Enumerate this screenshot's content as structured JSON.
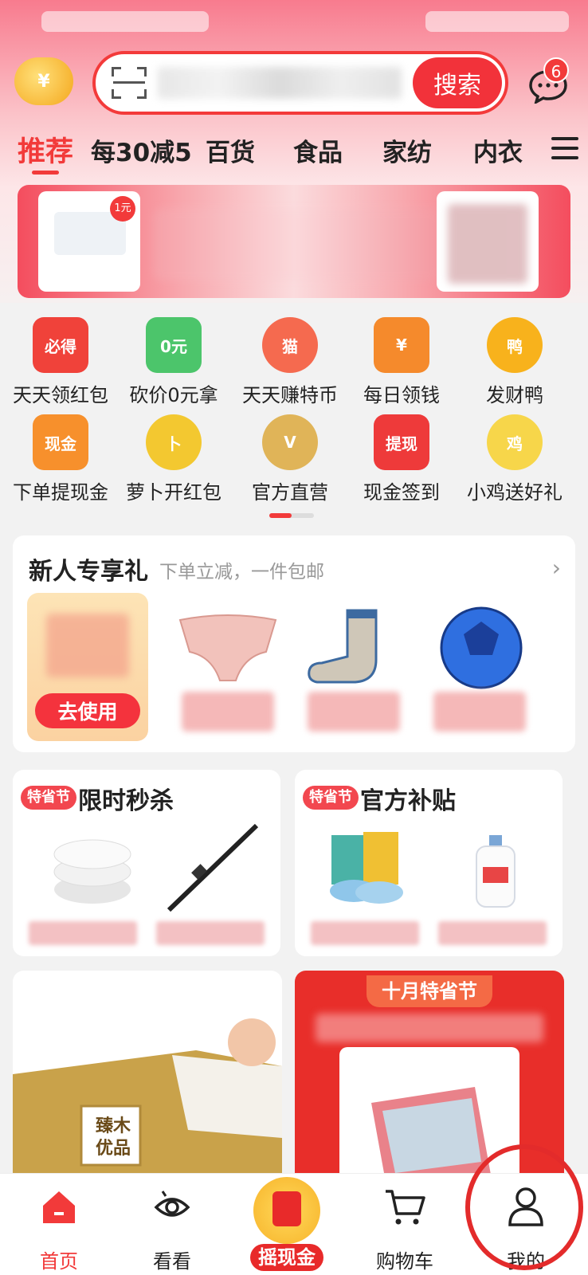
{
  "search": {
    "placeholder": "",
    "button_label": "搜索"
  },
  "messages": {
    "badge_count": "6"
  },
  "coin": {
    "symbol": "¥"
  },
  "tabs": [
    {
      "label": "推荐",
      "active": true
    },
    {
      "label": "每30减5"
    },
    {
      "label": "百货"
    },
    {
      "label": "食品"
    },
    {
      "label": "家纺"
    },
    {
      "label": "内衣"
    }
  ],
  "banner": {
    "left_badge": "1元"
  },
  "grid_items": [
    {
      "label": "天天领红包",
      "icon": "red-envelope-icon",
      "glyph": "必得",
      "color": "#f0423a"
    },
    {
      "label": "砍价0元拿",
      "icon": "zero-yuan-hand-icon",
      "glyph": "0元",
      "color": "#4cc56b"
    },
    {
      "label": "天天赚特币",
      "icon": "cat-mascot-icon",
      "glyph": "猫",
      "color": "#f56a4f"
    },
    {
      "label": "每日领钱",
      "icon": "wallet-icon",
      "glyph": "¥",
      "color": "#f58a2c"
    },
    {
      "label": "发财鸭",
      "icon": "duck-icon",
      "glyph": "鸭",
      "color": "#f8b21c"
    },
    {
      "label": "下单提现金",
      "icon": "cash-cart-icon",
      "glyph": "现金",
      "color": "#f7902c"
    },
    {
      "label": "萝卜开红包",
      "icon": "radish-icon",
      "glyph": "卜",
      "color": "#f3c830"
    },
    {
      "label": "官方直营",
      "icon": "rabbit-v-icon",
      "glyph": "V",
      "color": "#e0b458"
    },
    {
      "label": "现金签到",
      "icon": "cash-checkin-icon",
      "glyph": "提现",
      "color": "#ee3a3a"
    },
    {
      "label": "小鸡送好礼",
      "icon": "chick-icon",
      "glyph": "鸡",
      "color": "#f7d64a"
    }
  ],
  "newcomer": {
    "title": "新人专享礼",
    "subtitle": "下单立减，一件包邮",
    "coupon_button": "去使用"
  },
  "sections": [
    {
      "badge": "特省节",
      "title": "限时秒杀"
    },
    {
      "badge": "特省节",
      "title": "官方补贴"
    }
  ],
  "festival": {
    "title": "十月特省节"
  },
  "paper_brand": "臻木优品",
  "nav": [
    {
      "label": "首页",
      "icon": "home-icon",
      "active": true
    },
    {
      "label": "看看",
      "icon": "eye-icon"
    },
    {
      "label": "摇现金",
      "icon": "shake-cash-icon"
    },
    {
      "label": "购物车",
      "icon": "cart-icon"
    },
    {
      "label": "我的",
      "icon": "user-icon"
    }
  ],
  "colors": {
    "accent": "#f23a3a"
  }
}
